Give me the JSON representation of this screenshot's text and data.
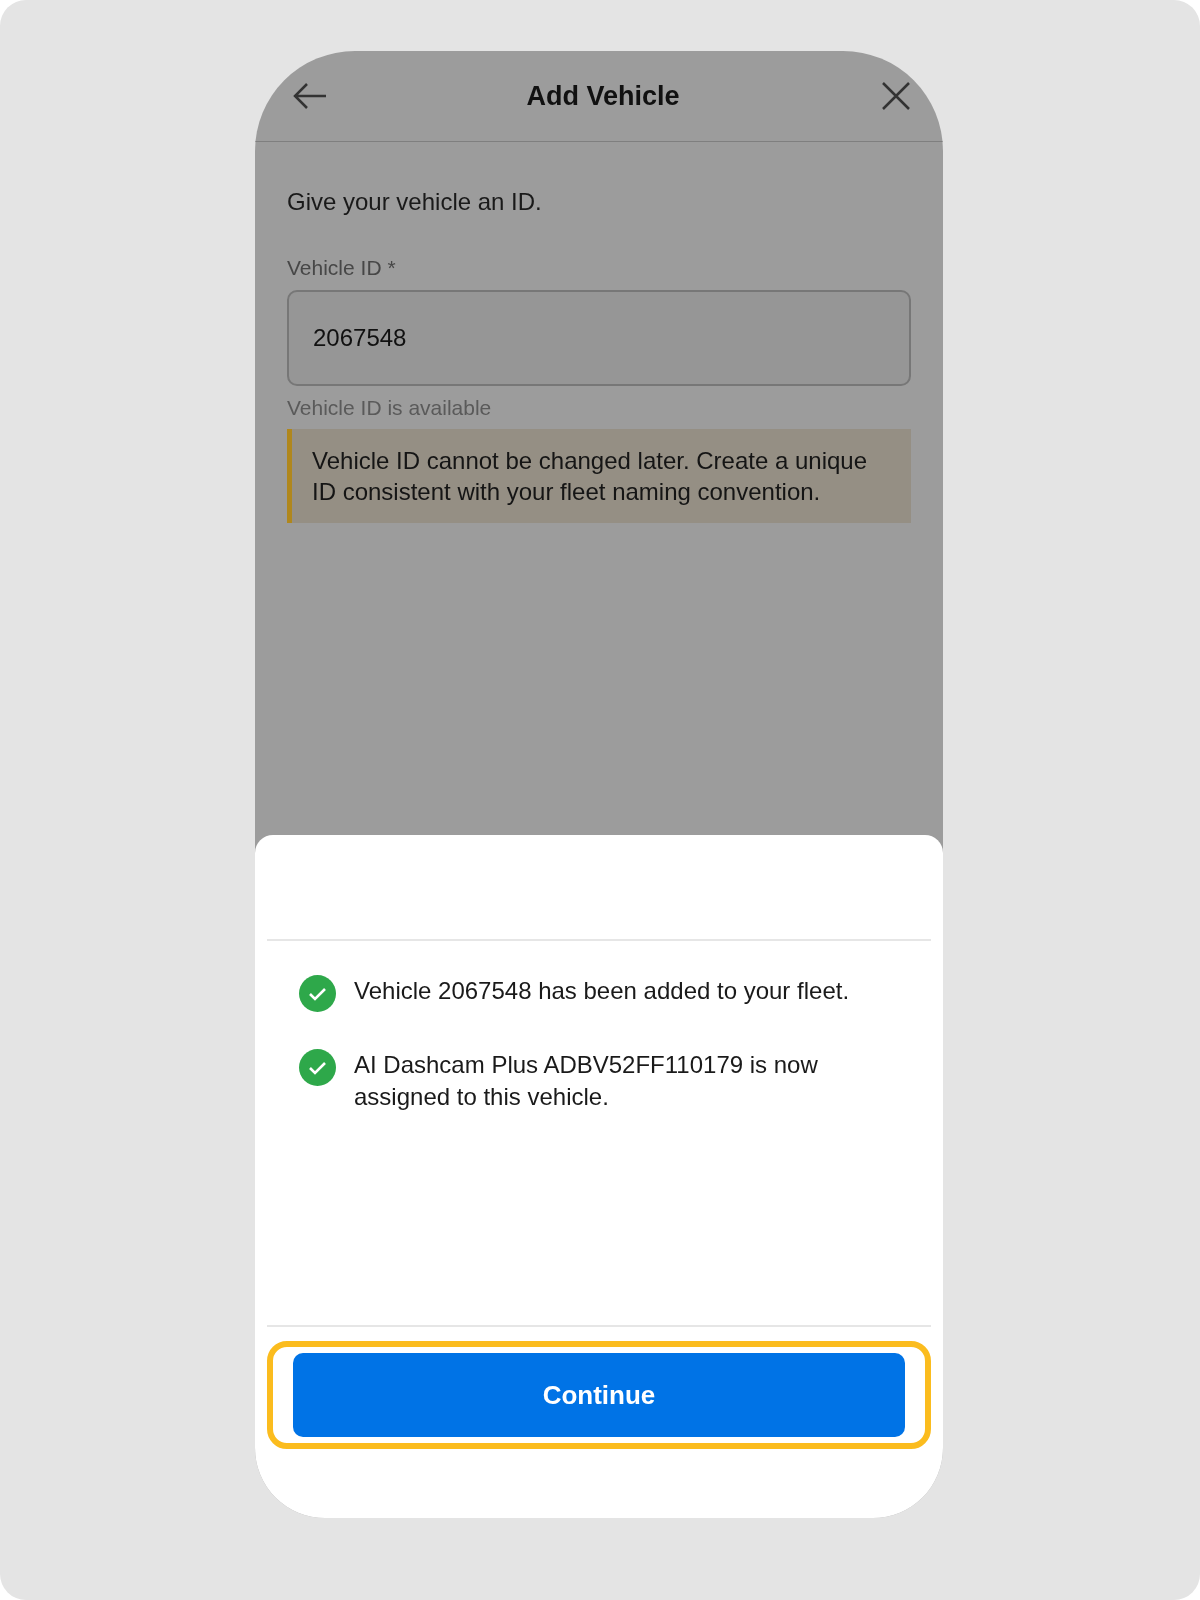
{
  "header": {
    "title": "Add Vehicle"
  },
  "form": {
    "intro": "Give your vehicle an ID.",
    "field_label": "Vehicle ID *",
    "field_value": "2067548",
    "helper": "Vehicle ID is available",
    "warning": "Vehicle ID cannot be changed later. Create a unique ID consistent with your fleet naming convention."
  },
  "sheet": {
    "messages": [
      {
        "text": "Vehicle 2067548 has been added to your fleet."
      },
      {
        "text": "AI Dashcam Plus ADBV52FF110179 is now assigned to this vehicle."
      }
    ],
    "button": {
      "label": "Continue",
      "focused": true
    }
  }
}
